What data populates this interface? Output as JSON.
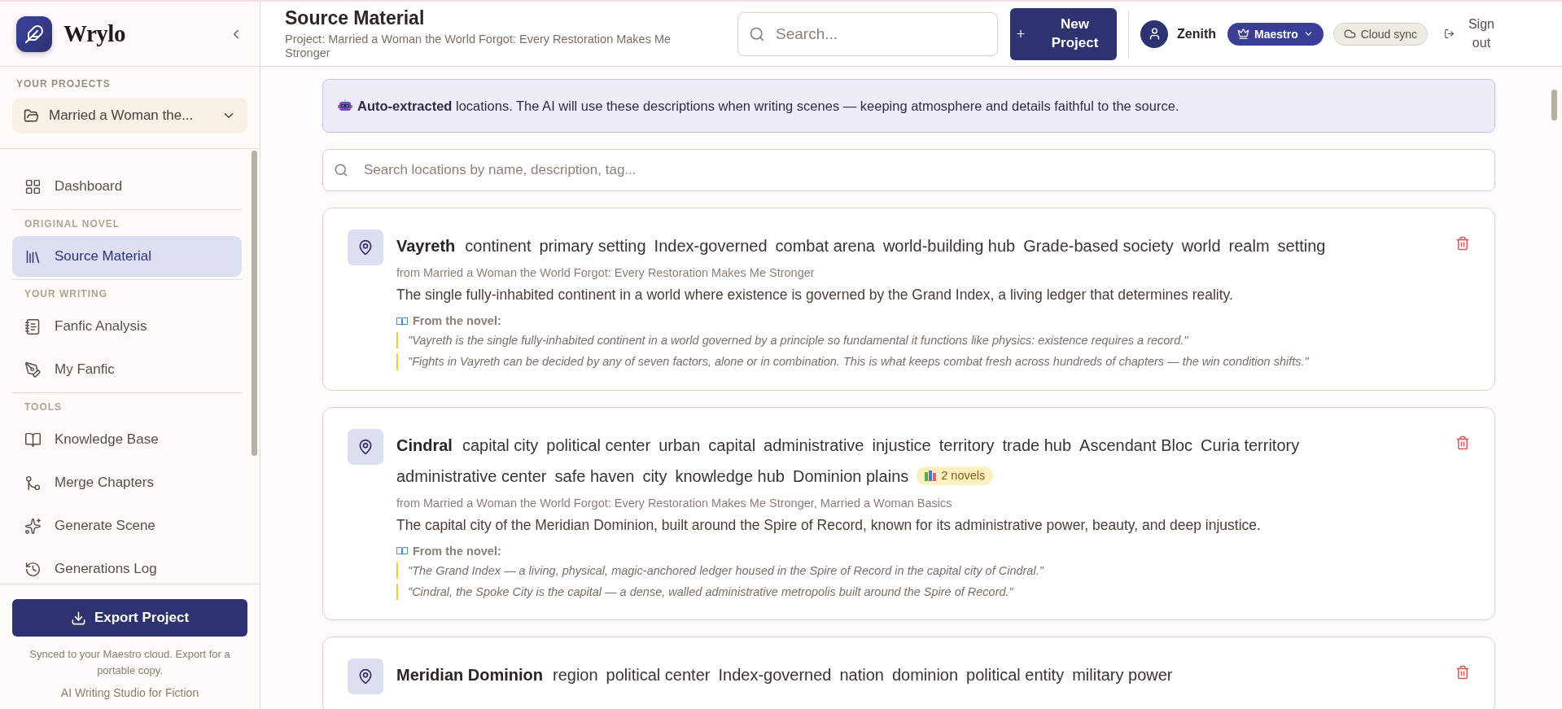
{
  "brand": {
    "name": "Wrylo"
  },
  "sidebar": {
    "projects_label": "YOUR PROJECTS",
    "project": "Married a Woman the...",
    "nav": [
      {
        "kind": "item",
        "label": "Dashboard",
        "selected": false
      },
      {
        "kind": "heading",
        "label": "ORIGINAL NOVEL"
      },
      {
        "kind": "item",
        "label": "Source Material",
        "selected": true
      },
      {
        "kind": "heading",
        "label": "YOUR WRITING"
      },
      {
        "kind": "item",
        "label": "Fanfic Analysis",
        "selected": false
      },
      {
        "kind": "item",
        "label": "My Fanfic",
        "selected": false
      },
      {
        "kind": "heading",
        "label": "TOOLS"
      },
      {
        "kind": "item",
        "label": "Knowledge Base",
        "selected": false
      },
      {
        "kind": "item",
        "label": "Merge Chapters",
        "selected": false
      },
      {
        "kind": "item",
        "label": "Generate Scene",
        "selected": false
      },
      {
        "kind": "item",
        "label": "Generations Log",
        "selected": false
      }
    ],
    "export_button": "Export Project",
    "sync_note": "Synced to your Maestro cloud. Export for a portable copy.",
    "tagline": "AI Writing Studio for Fiction"
  },
  "header": {
    "title": "Source Material",
    "subtitle": "Project: Married a Woman the World Forgot: Every Restoration Makes Me Stronger",
    "search_placeholder": "Search...",
    "new_project": "New Project",
    "user": "Zenith",
    "plan": "Maestro",
    "sync": "Cloud sync",
    "sign_out": "Sign out"
  },
  "banner": "**Auto-extracted** locations. The AI will use these descriptions when writing scenes — keeping atmosphere and details faithful to the source.",
  "location_search_placeholder": "Search locations by name, description, tag...",
  "locations": [
    {
      "name": "Vayreth",
      "tags": [
        "continent",
        "primary setting",
        "Index-governed",
        "combat arena",
        "world-building hub",
        "Grade-based society",
        "world",
        "realm",
        "setting"
      ],
      "source": "from Married a Woman the World Forgot: Every Restoration Makes Me Stronger",
      "description": "The single fully-inhabited continent in a world where existence is governed by the Grand Index, a living ledger that determines reality.",
      "quotes_label": "From the novel:",
      "quotes": [
        "\"Vayreth is the single fully-inhabited continent in a world governed by a principle so fundamental it functions like physics: existence requires a record.\"",
        "\"Fights in Vayreth can be decided by any of seven factors, alone or in combination. This is what keeps combat fresh across hundreds of chapters — the win condition shifts.\""
      ]
    },
    {
      "name": "Cindral",
      "tags": [
        "capital city",
        "political center",
        "urban",
        "capital",
        "administrative",
        "injustice",
        "territory",
        "trade hub",
        "Ascendant Bloc",
        "Curia territory",
        "administrative center",
        "safe haven",
        "city",
        "knowledge hub",
        "Dominion plains"
      ],
      "badge": "2 novels",
      "source": "from Married a Woman the World Forgot: Every Restoration Makes Me Stronger, Married a Woman Basics",
      "description": "The capital city of the Meridian Dominion, built around the Spire of Record, known for its administrative power, beauty, and deep injustice.",
      "quotes_label": "From the novel:",
      "quotes": [
        "\"The Grand Index — a living, physical, magic-anchored ledger housed in the Spire of Record in the capital city of Cindral.\"",
        "\"Cindral, the Spoke City is the capital — a dense, walled administrative metropolis built around the Spire of Record.\""
      ]
    },
    {
      "name": "Meridian Dominion",
      "tags": [
        "region",
        "political center",
        "Index-governed",
        "nation",
        "dominion",
        "political entity",
        "military power"
      ]
    }
  ]
}
